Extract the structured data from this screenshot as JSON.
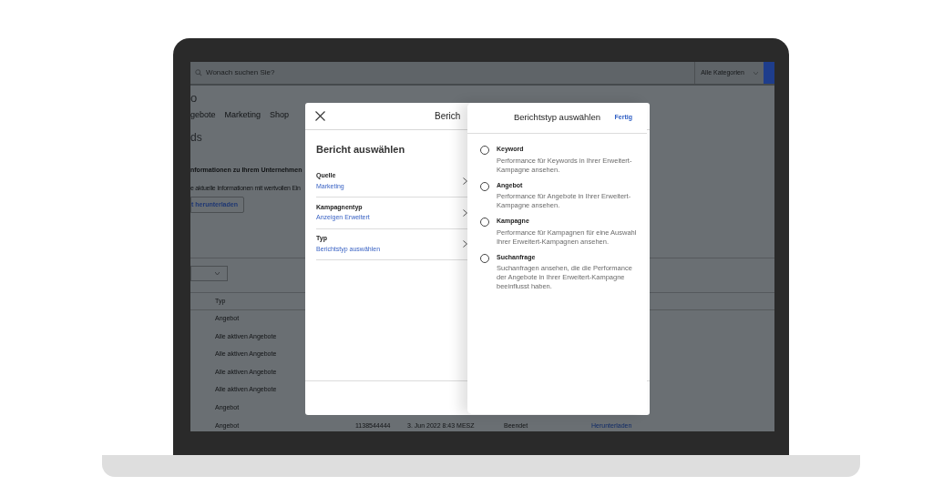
{
  "search": {
    "placeholder": "Wonach suchen Sie?"
  },
  "category_select": {
    "value": "Alle Kategorien"
  },
  "logo": "o",
  "nav": [
    "gebote",
    "Marketing",
    "Shop"
  ],
  "page_title": "ds",
  "info": {
    "title": "nformationen zu Ihrem Unternehmen",
    "text": "e aktuelle Informationen mit wertvollen Ein",
    "button": "t herunterladen"
  },
  "table": {
    "column_1": "Typ",
    "rows": [
      {
        "type": "Angebot"
      },
      {
        "type": "Alle aktiven Angebote"
      },
      {
        "type": "Alle aktiven Angebote"
      },
      {
        "type": "Alle aktiven Angebote"
      },
      {
        "type": "Alle aktiven Angebote"
      },
      {
        "type": "Angebot"
      },
      {
        "type": "Angebot",
        "number": "1138544444",
        "date": "3. Jun 2022 8:43 MESZ",
        "status": "Beendet",
        "action": "Herunterladen"
      }
    ]
  },
  "report_dialog": {
    "title": "Berich",
    "heading": "Bericht auswählen",
    "rows": [
      {
        "label": "Quelle",
        "value": "Marketing"
      },
      {
        "label": "Kampagnentyp",
        "value": "Anzeigen Erweitert"
      },
      {
        "label": "Typ",
        "value": "Berichtstyp auswählen"
      }
    ]
  },
  "type_panel": {
    "title": "Berichtstyp auswählen",
    "done": "Fertig",
    "options": [
      {
        "label": "Keyword",
        "description": "Performance für Keywords in Ihrer Erweitert-Kampagne ansehen.",
        "selected": false
      },
      {
        "label": "Angebot",
        "description": "Performance für Angebote in Ihrer Erweitert-Kampagne ansehen.",
        "selected": false
      },
      {
        "label": "Kampagne",
        "description": "Performance für Kampagnen für eine Auswahl Ihrer Erweitert-Kampagnen ansehen.",
        "selected": false
      },
      {
        "label": "Suchanfrage",
        "description": "Suchanfragen ansehen, die die Performance der Angebote in Ihrer Erweitert-Kampagne beeinflusst haben.",
        "selected": false
      }
    ]
  }
}
